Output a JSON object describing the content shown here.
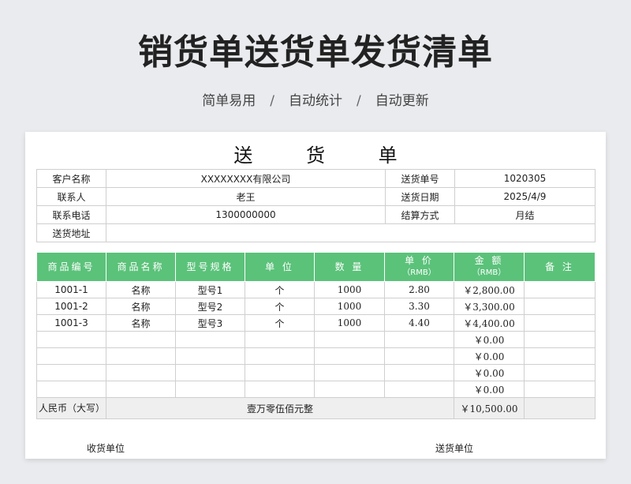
{
  "header": {
    "title": "销货单送货单发货清单",
    "subtitle_items": [
      "简单易用",
      "自动统计",
      "自动更新"
    ],
    "separator": "/"
  },
  "document": {
    "title": "送 货 单",
    "info": {
      "customer_label": "客户名称",
      "customer_value": "XXXXXXXX有限公司",
      "order_no_label": "送货单号",
      "order_no_value": "1020305",
      "contact_label": "联系人",
      "contact_value": "老王",
      "date_label": "送货日期",
      "date_value": "2025/4/9",
      "phone_label": "联系电话",
      "phone_value": "1300000000",
      "settle_label": "结算方式",
      "settle_value": "月结",
      "address_label": "送货地址",
      "address_value": ""
    },
    "columns": {
      "code": "商品编号",
      "name": "商品名称",
      "model": "型号规格",
      "unit": "单 位",
      "qty": "数 量",
      "price": "单 价",
      "price_unit": "（RMB）",
      "amount": "金 额",
      "amount_unit": "（RMB）",
      "note": "备 注"
    },
    "rows": [
      {
        "code": "1001-1",
        "name": "名称",
        "model": "型号1",
        "unit": "个",
        "qty": "1000",
        "price": "2.80",
        "amount": "￥2,800.00",
        "note": ""
      },
      {
        "code": "1001-2",
        "name": "名称",
        "model": "型号2",
        "unit": "个",
        "qty": "1000",
        "price": "3.30",
        "amount": "￥3,300.00",
        "note": ""
      },
      {
        "code": "1001-3",
        "name": "名称",
        "model": "型号3",
        "unit": "个",
        "qty": "1000",
        "price": "4.40",
        "amount": "￥4,400.00",
        "note": ""
      },
      {
        "code": "",
        "name": "",
        "model": "",
        "unit": "",
        "qty": "",
        "price": "",
        "amount": "￥0.00",
        "note": ""
      },
      {
        "code": "",
        "name": "",
        "model": "",
        "unit": "",
        "qty": "",
        "price": "",
        "amount": "￥0.00",
        "note": ""
      },
      {
        "code": "",
        "name": "",
        "model": "",
        "unit": "",
        "qty": "",
        "price": "",
        "amount": "￥0.00",
        "note": ""
      },
      {
        "code": "",
        "name": "",
        "model": "",
        "unit": "",
        "qty": "",
        "price": "",
        "amount": "￥0.00",
        "note": ""
      }
    ],
    "total": {
      "label": "人民币（大写）",
      "words": "壹万零伍佰元整",
      "amount": "￥10,500.00"
    },
    "footer": {
      "receiver_label": "收货单位",
      "sender_label": "送货单位"
    }
  }
}
